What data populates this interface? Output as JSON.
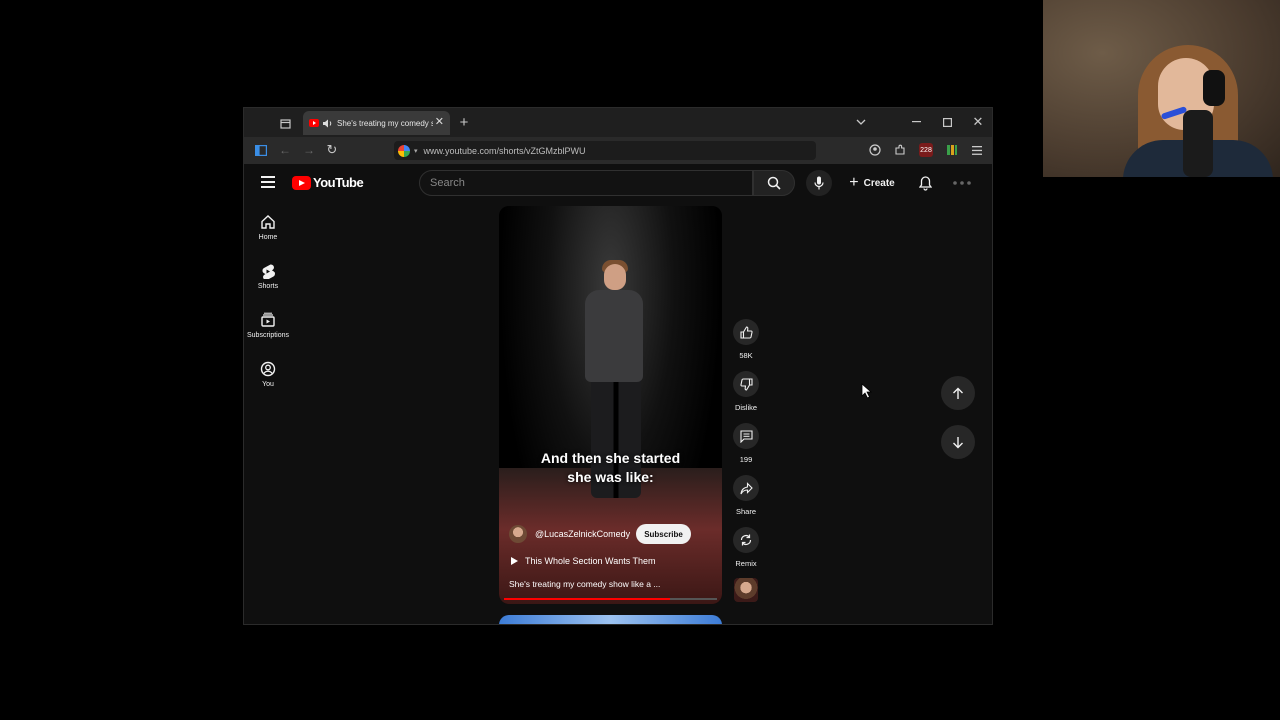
{
  "browser": {
    "tab": {
      "title": "She's treating my comedy s",
      "audio_icon": "speaker-icon"
    },
    "new_tab_label": "+",
    "url": "www.youtube.com/shorts/vZtGMzblPWU",
    "extension_badge": "228"
  },
  "youtube": {
    "logo_text": "YouTube",
    "search_placeholder": "Search",
    "create_label": "Create",
    "nav": [
      {
        "label": "Home",
        "icon": "home-icon"
      },
      {
        "label": "Shorts",
        "icon": "shorts-icon"
      },
      {
        "label": "Subscriptions",
        "icon": "subscriptions-icon"
      },
      {
        "label": "You",
        "icon": "you-icon"
      }
    ],
    "short": {
      "caption_line1": "And then she started",
      "caption_line2": "she was like:",
      "channel": "@LucasZelnickComedy",
      "subscribe_label": "Subscribe",
      "sound": "This Whole Section Wants Them",
      "title": "She's treating my comedy show like a ...",
      "progress": 0.78
    },
    "actions": {
      "likes": "58K",
      "dislike": "Dislike",
      "comments": "199",
      "share": "Share",
      "remix": "Remix"
    }
  }
}
